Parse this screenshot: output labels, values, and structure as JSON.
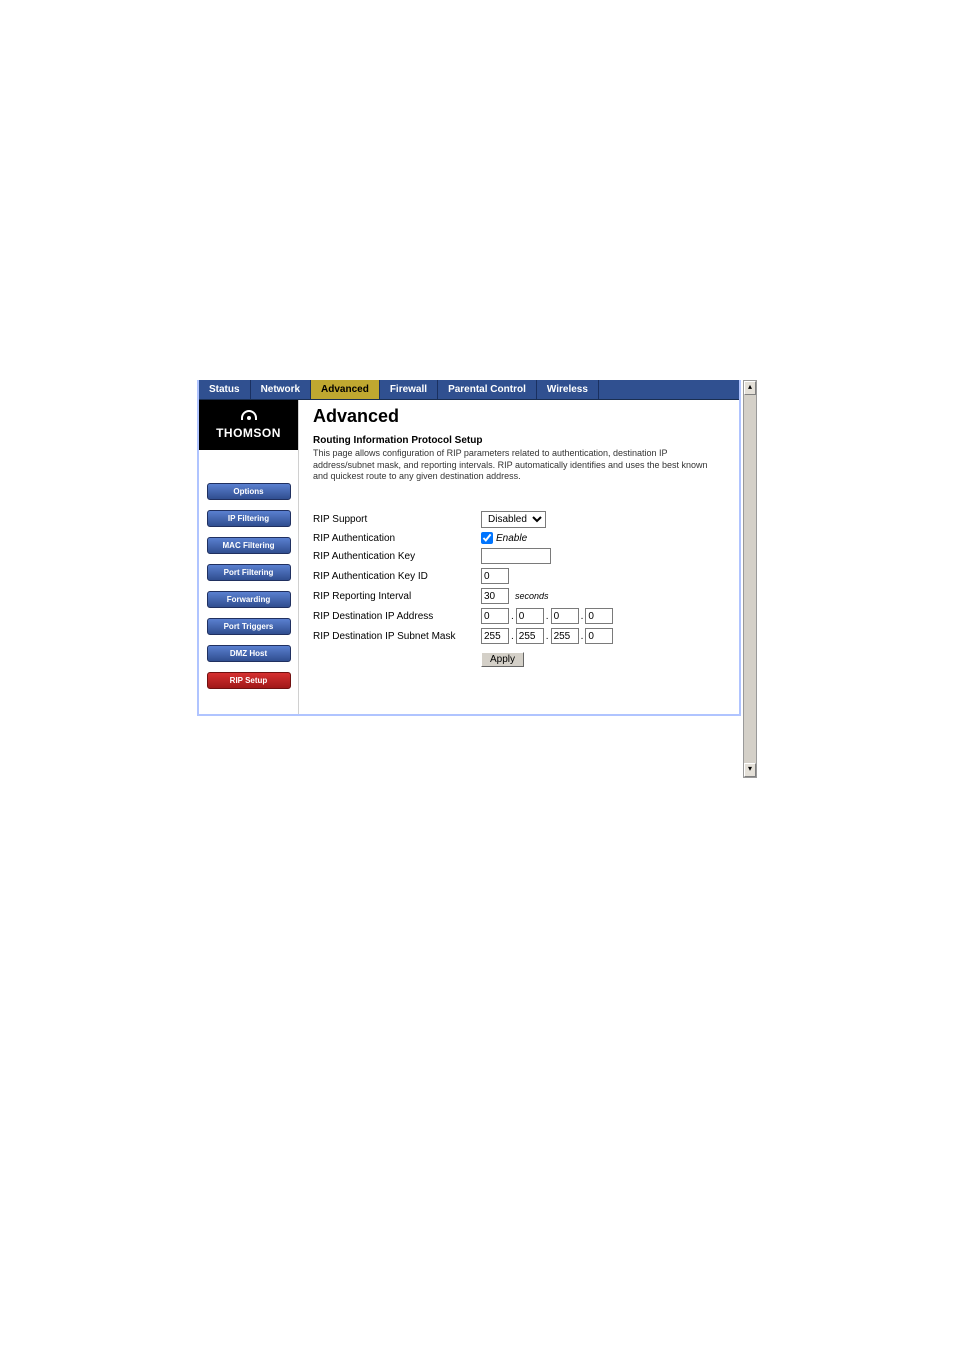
{
  "tabs": {
    "status": "Status",
    "network": "Network",
    "advanced": "Advanced",
    "firewall": "Firewall",
    "parental": "Parental Control",
    "wireless": "Wireless"
  },
  "brand": {
    "name": "THOMSON"
  },
  "nav": {
    "options": "Options",
    "ip_filtering": "IP Filtering",
    "mac_filtering": "MAC Filtering",
    "port_filtering": "Port Filtering",
    "forwarding": "Forwarding",
    "port_triggers": "Port Triggers",
    "dmz_host": "DMZ Host",
    "rip_setup": "RIP Setup"
  },
  "page": {
    "title": "Advanced",
    "section_title": "Routing Information Protocol Setup",
    "section_desc": "This page allows configuration of RIP parameters related to authentication, destination IP address/subnet mask, and reporting intervals.  RIP automatically identifies and uses the best known and quickest route to any given destination address."
  },
  "form": {
    "rip_support_label": "RIP Support",
    "rip_support_value": "Disabled",
    "rip_auth_label": "RIP Authentication",
    "rip_auth_cb_label": "Enable",
    "rip_auth_key_label": "RIP Authentication Key",
    "rip_auth_key_value": "",
    "rip_auth_keyid_label": "RIP Authentication Key ID",
    "rip_auth_keyid_value": "0",
    "rip_interval_label": "RIP Reporting Interval",
    "rip_interval_value": "30",
    "rip_interval_units": "seconds",
    "rip_dest_ip_label": "RIP Destination IP Address",
    "rip_dest_ip": [
      "0",
      "0",
      "0",
      "0"
    ],
    "rip_dest_mask_label": "RIP Destination IP Subnet Mask",
    "rip_dest_mask": [
      "255",
      "255",
      "255",
      "0"
    ],
    "apply": "Apply"
  },
  "scroll": {
    "up": "▴",
    "down": "▾"
  }
}
